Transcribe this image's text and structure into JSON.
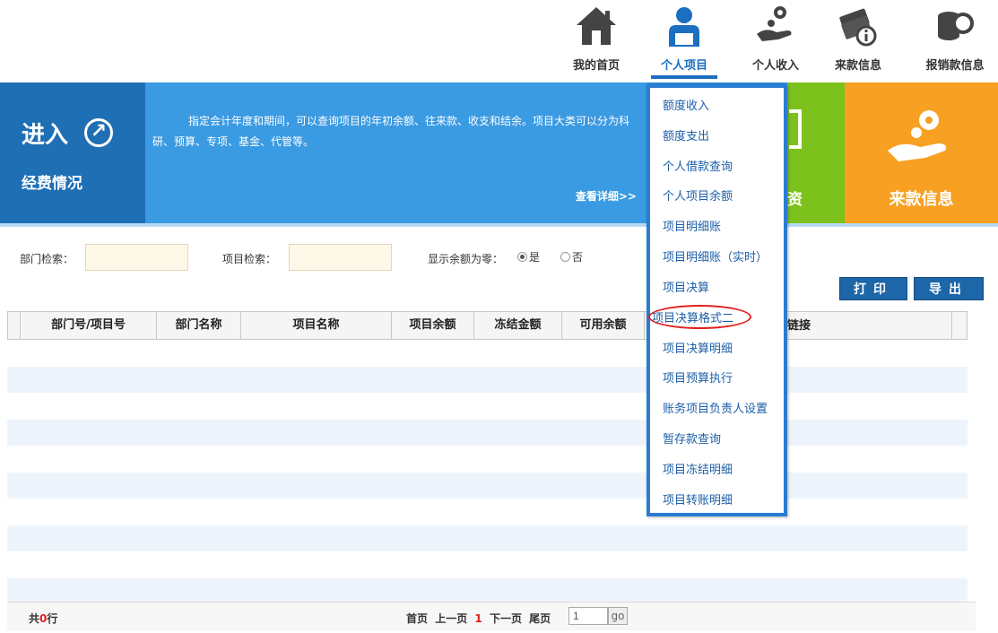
{
  "nav": [
    {
      "label": "我的首页",
      "icon": "home-icon",
      "active": false
    },
    {
      "label": "个人项目",
      "icon": "person-icon",
      "active": true
    },
    {
      "label": "个人收入",
      "icon": "hand-coin-icon",
      "active": false
    },
    {
      "label": "来款信息",
      "icon": "money-info-icon",
      "active": false
    },
    {
      "label": "报销款信息",
      "icon": "coins-search-icon",
      "active": false
    }
  ],
  "banner": {
    "enter_title": "进入",
    "enter_subtitle": "经费情况",
    "description": "指定会计年度和期间，可以查询项目的年初余额、往来款、收支和结余。项目大类可以分为科研、预算、专项、基金、代管等。",
    "more_link": "查看详细>>",
    "green_tile_partial": "资",
    "orange_tile_label": "来款信息"
  },
  "filter": {
    "dept_label": "部门检索：",
    "dept_value": "",
    "project_label": "项目检索：",
    "project_value": "",
    "zero_label": "显示余额为零：",
    "yes_label": "是",
    "no_label": "否",
    "selected": "yes"
  },
  "buttons": {
    "print": "打印",
    "export": "导出"
  },
  "table": {
    "columns": [
      "部门号/项目号",
      "部门名称",
      "项目名称",
      "项目余额",
      "冻结金额",
      "可用余额",
      "",
      "链接"
    ],
    "rows": []
  },
  "footer": {
    "total_prefix": "共",
    "total_count": "0",
    "total_suffix": "行",
    "first": "首页",
    "prev": "上一页",
    "current": "1",
    "next": "下一页",
    "last": "尾页",
    "page_input": "1",
    "go": "go"
  },
  "dropdown": {
    "items": [
      "额度收入",
      "额度支出",
      "个人借款查询",
      "个人项目余额",
      "项目明细账",
      "项目明细账（实时）",
      "项目决算",
      "项目决算格式二",
      "项目决算明细",
      "项目预算执行",
      "账务项目负责人设置",
      "暂存款查询",
      "项目冻结明细",
      "项目转账明细"
    ],
    "highlighted_index": 7
  },
  "colors": {
    "primary_blue": "#1f6fb5",
    "banner_blue": "#3a9ae2",
    "green": "#7dc21c",
    "orange": "#f7a022",
    "highlight_red": "#e02020"
  }
}
